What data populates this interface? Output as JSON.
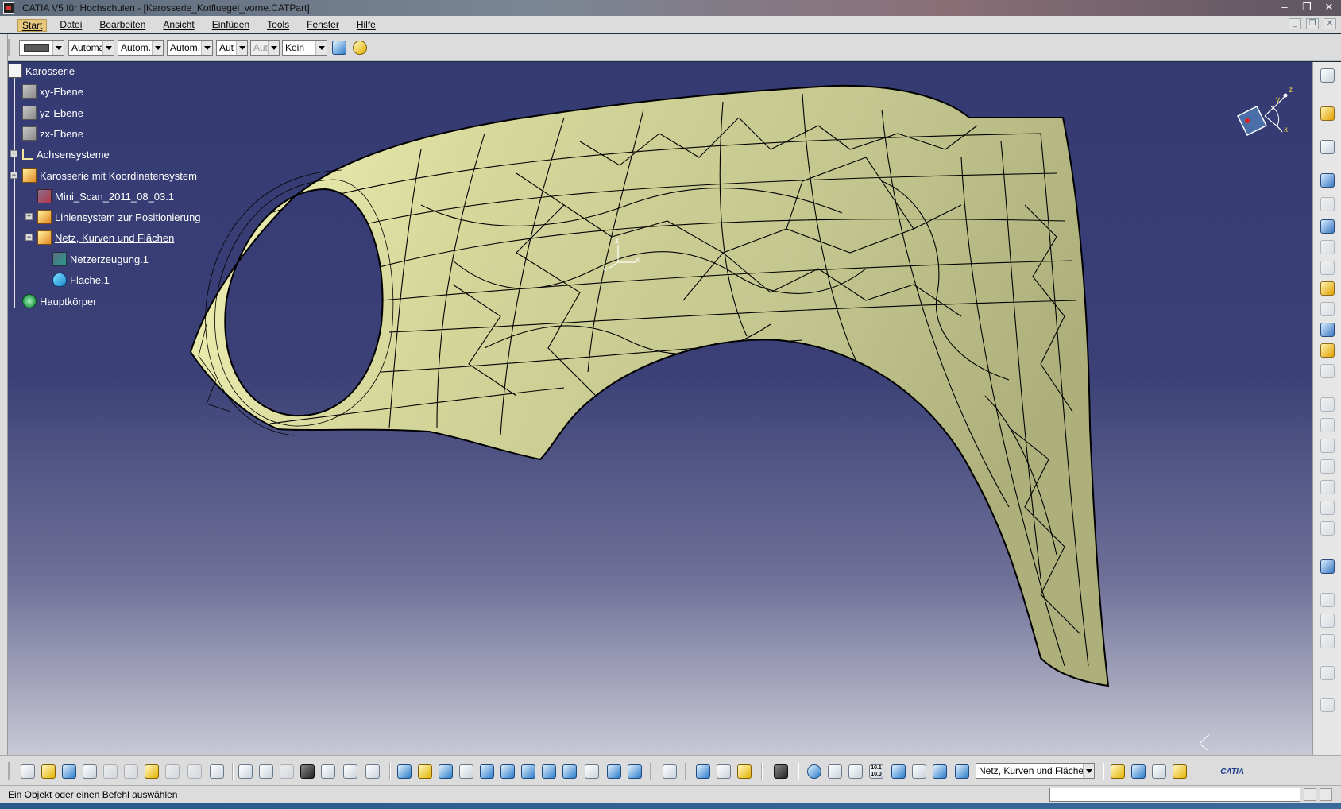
{
  "window": {
    "title": "CATIA V5 für Hochschulen - [Karosserie_Kotfluegel_vorne.CATPart]"
  },
  "menu": {
    "items": [
      "Start",
      "Datei",
      "Bearbeiten",
      "Ansicht",
      "Einfügen",
      "Tools",
      "Fenster",
      "Hilfe"
    ]
  },
  "properties_toolbar": {
    "combos": [
      "Automa",
      "Autom.",
      "Autom.",
      "Aut",
      "Aut",
      "Kein"
    ]
  },
  "tree": {
    "nodes": [
      {
        "label": "Karosserie",
        "icon": "part-icon"
      },
      {
        "label": "xy-Ebene",
        "icon": "plane-icon"
      },
      {
        "label": "yz-Ebene",
        "icon": "plane-icon"
      },
      {
        "label": "zx-Ebene",
        "icon": "plane-icon"
      },
      {
        "label": "Achsensysteme",
        "icon": "axis-system-icon"
      },
      {
        "label": "Karosserie mit Koordinatensystem",
        "icon": "geometrical-set-icon"
      },
      {
        "label": "Mini_Scan_2011_08_03.1",
        "icon": "cloud-scan-icon"
      },
      {
        "label": "Liniensystem zur Positionierung",
        "icon": "geometrical-set-icon"
      },
      {
        "label": "Netz, Kurven und Flächen",
        "icon": "geometrical-set-icon"
      },
      {
        "label": "Netzerzeugung.1",
        "icon": "mesh-icon"
      },
      {
        "label": "Fläche.1",
        "icon": "surface-icon"
      },
      {
        "label": "Hauptkörper",
        "icon": "body-icon"
      }
    ]
  },
  "viewport": {
    "axis_label_x": "x",
    "axis_label_y": "y",
    "axis_label_z": "z",
    "compass_x": "x",
    "compass_y": "y",
    "compass_z": "z"
  },
  "bottom_toolbar": {
    "current_set": "Netz, Kurven und Flächen",
    "analysis_label": "10.1\n10.0",
    "catia_logo": "CATIA"
  },
  "status": {
    "message": "Ein Objekt oder einen Befehl auswählen"
  },
  "colors": {
    "viewport_top": "#343a72",
    "viewport_bottom": "#c8c9d6",
    "part_surface": "#e6e6a8",
    "mesh_lines": "#000000",
    "menu_active": "#e8c880"
  }
}
